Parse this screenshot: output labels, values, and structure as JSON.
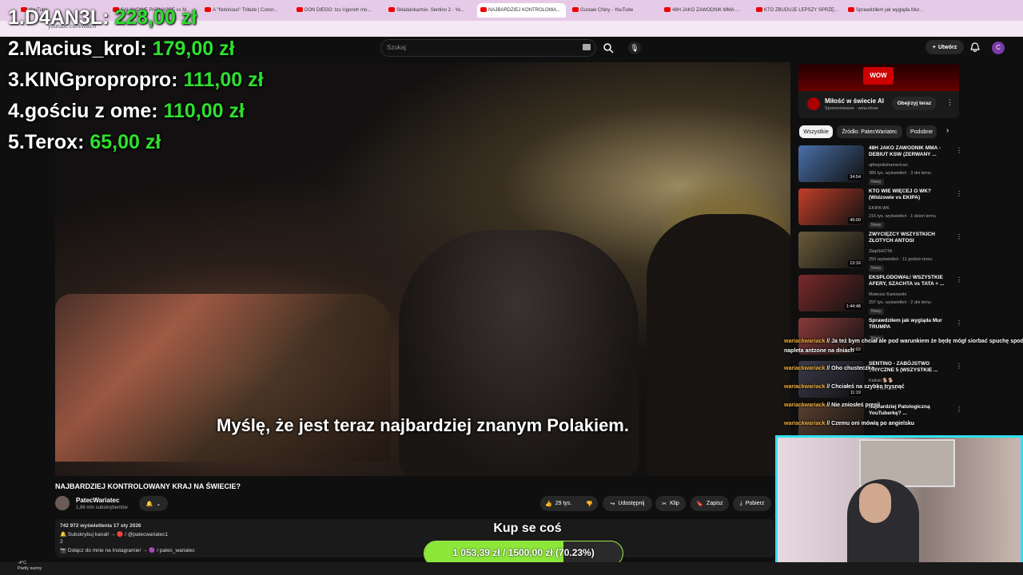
{
  "browser": {
    "tabs": [
      {
        "label": "YouTube",
        "active": false
      },
      {
        "label": "SALAHDINE PARNASSE vs M...",
        "active": false
      },
      {
        "label": "A \"Notorious\" Tribute | Conor...",
        "active": false
      },
      {
        "label": "DON DIEGO: Izu Ugonoh mó...",
        "active": false
      },
      {
        "label": "Składanka/mix- Sentino 2 - Yo...",
        "active": false
      },
      {
        "label": "NAJBARDZIEJ KONTROLOWA...",
        "active": true
      },
      {
        "label": "Gustaw Chiny - YouTube",
        "active": false
      },
      {
        "label": "48H JAKO ZAWODNIK MMA ...",
        "active": false
      },
      {
        "label": "KTO ZBUDUJE LEPSZY SPRZĘ...",
        "active": false
      },
      {
        "label": "Sprawdziłem jak wygląda Mur...",
        "active": false
      }
    ],
    "url": "youtube.com/watch"
  },
  "youtube": {
    "search_placeholder": "Szukaj",
    "create_label": "Utwórz",
    "avatar_letter": "C"
  },
  "leaderboard": [
    {
      "rank": "1.",
      "name": "D4AN3L:",
      "amount": "228,00 zł"
    },
    {
      "rank": "2.",
      "name": "Macius_krol:",
      "amount": "179,00 zł"
    },
    {
      "rank": "3.",
      "name": "KINGpropropro:",
      "amount": "111,00 zł"
    },
    {
      "rank": "4.",
      "name": "gościu z ome:",
      "amount": "110,00 zł"
    },
    {
      "rank": "5.",
      "name": "Terox:",
      "amount": "65,00 zł"
    }
  ],
  "video": {
    "subtitle": "Myślę, że jest teraz najbardziej znanym Polakiem.",
    "title": "NAJBARDZIEJ KONTROLOWANY KRAJ NA ŚWIECIE?",
    "channel": "PatecWariatec",
    "subscribers": "1,86 mln subskrybentów",
    "likes": "29 tys.",
    "share_label": "Udostępnij",
    "clip_label": "Klip",
    "save_label": "Zapisz",
    "download_label": "Pobierz",
    "desc_line1": "742 972 wyświetlenia  17 sty 2026",
    "desc_line2": "🔔 Subskrybuj kanał! → 🔴 / @patecwariatec1",
    "desc_line3": "2",
    "desc_line4": "📷 Dołącz do mnie na Instagramie! → 🟣 / patec_wariatec"
  },
  "goal": {
    "title": "Kup se coś",
    "text": "1 053,39 zł / 1500,00 zł (70.23%)",
    "percent": 70.23
  },
  "ad": {
    "logo": "WOW",
    "title": "Miłość w świecie AI",
    "sponsor": "Sponsorowane · wow.show",
    "cta": "Obejrzyj teraz"
  },
  "chips": [
    "Wszystkie",
    "Źródło: PatecWariatec",
    "Podobne"
  ],
  "recommendations": [
    {
      "title": "48H JAKO ZAWODNIK MMA - DEBIUT KSW (ZERWANY ...",
      "channel": "ajthepolishamerican",
      "meta": "386 tys. wyświetleń · 3 dni temu",
      "badge": "Nowy",
      "duration": "34:54",
      "color": "#4a6fa8"
    },
    {
      "title": "KTO WIE WIĘCEJ O WK? (Widzowie vs EKIPA)",
      "channel": "EKIPA WK",
      "meta": "216 tys. wyświetleń · 1 dzień temu",
      "badge": "Nowy",
      "duration": "49:00",
      "color": "#c0402a"
    },
    {
      "title": "ZWYCIĘZCY WSZYSTKICH ZŁOTYCH ANTOSI",
      "channel": "ZłapSHOTA",
      "meta": "250 wyświetleń · 11 godzin temu",
      "badge": "Nowy",
      "duration": "13:16",
      "color": "#6a5a3a"
    },
    {
      "title": "EKSPLODOWAŁ! WSZYSTKIE AFERY, SZACHTA vs TATA + ...",
      "channel": "Mateusz Kaniowski",
      "meta": "297 tys. wyświetleń · 2 dni temu",
      "badge": "Nowy",
      "duration": "1:44:48",
      "color": "#7a2a2a"
    },
    {
      "title": "Sprawdziłem jak wygląda Mur TRUMPA",
      "channel": "",
      "meta": "",
      "badge": "Nowy",
      "duration": "24:02",
      "color": "#8a3a3a"
    },
    {
      "title": "SENTINO - ZABÓJSTWO ...RYCZNE 5 (WSZYSTKIE ...",
      "channel": "Kaliski 🐕🐕",
      "meta": "... · 3 dni temu",
      "badge": "",
      "duration": "11:19",
      "color": "#3a3a4a"
    },
    {
      "title": "Najbardziej Patologiczną YouTuberkę? ...",
      "channel": "",
      "meta": "",
      "badge": "",
      "duration": "",
      "color": "#5a4030"
    }
  ],
  "chat": [
    {
      "user": "wariackwariack",
      "text": "Ja też bym chciał ale pod warunkiem że będę mógł siorbać spuchę spod"
    },
    {
      "user": "",
      "text": "napleta antzone na dniach"
    },
    {
      "user": "wariackwariack",
      "text": "Oho chustecżka"
    },
    {
      "user": "wariackwariack",
      "text": "Chciałeś na szybko trysnąć"
    },
    {
      "user": "wariackwariack",
      "text": "Nie zniosłeś presji"
    },
    {
      "user": "wariackwariack",
      "text": "Czemu oni mówią po angielsku"
    }
  ],
  "taskbar": {
    "temp": "-4°C",
    "weather": "Partly sunny"
  }
}
